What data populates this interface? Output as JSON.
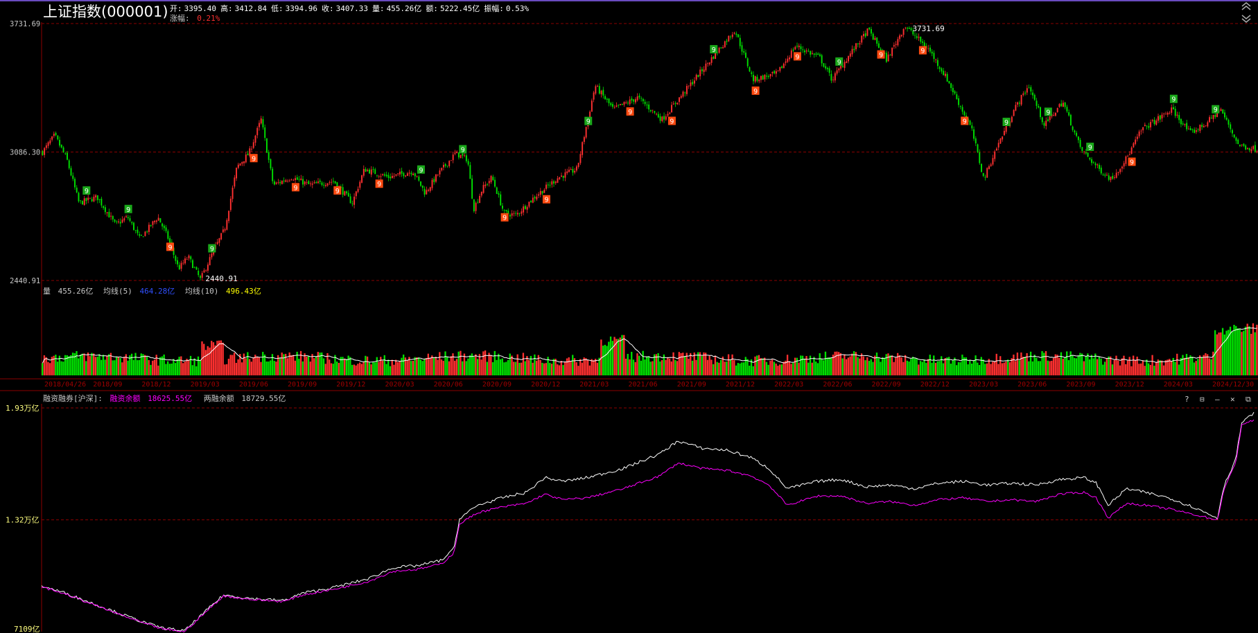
{
  "header": {
    "title": "上证指数(000001)",
    "ohlc_line": [
      {
        "k": "开:",
        "v": "3395.40"
      },
      {
        "k": "高:",
        "v": "3412.84"
      },
      {
        "k": "低:",
        "v": "3394.96"
      },
      {
        "k": "收:",
        "v": "3407.33"
      },
      {
        "k": "量:",
        "v": "455.26亿"
      },
      {
        "k": "额:",
        "v": "5222.45亿"
      },
      {
        "k": "振幅:",
        "v": "0.53%"
      }
    ],
    "change_label": "涨幅:",
    "change_value": "0.21%"
  },
  "volume_header": {
    "label": "量",
    "value": "455.26亿",
    "ma5_label": "均线(5)",
    "ma5_value": "464.28亿",
    "ma10_label": "均线(10)",
    "ma10_value": "496.43亿"
  },
  "margin_header": {
    "label": "融资融券[沪深]:",
    "rz_label": "融资余额",
    "rz_value": "18625.55亿",
    "lr_label": "两融余额",
    "lr_value": "18729.55亿"
  },
  "panel_buttons": [
    "?",
    "⊟",
    "–",
    "✕",
    "⧉"
  ],
  "colors": {
    "up": "#ff3030",
    "down": "#00e000",
    "grid": "#8b0000",
    "axis_text": "#c8c8c8",
    "rz_line": "#ff00ff",
    "lr_line": "#ffffff",
    "ma5": "#3050ff",
    "ma10": "#ffff00",
    "date_text": "#a00000",
    "td_green": "#1aa81a",
    "td_orange": "#ff4a10"
  },
  "chart_data": [
    {
      "type": "candlestick",
      "name": "price",
      "ylim": [
        2440.91,
        3731.69
      ],
      "yticks": [
        "3731.69",
        "3086.30",
        "2440.91"
      ],
      "high_label": "3731.69",
      "low_label": "2440.91",
      "keypoints": [
        {
          "t": 0.0,
          "v": 3086
        },
        {
          "t": 0.01,
          "v": 3170
        },
        {
          "t": 0.02,
          "v": 3050
        },
        {
          "t": 0.03,
          "v": 2830
        },
        {
          "t": 0.045,
          "v": 2860
        },
        {
          "t": 0.06,
          "v": 2720
        },
        {
          "t": 0.07,
          "v": 2760
        },
        {
          "t": 0.08,
          "v": 2650
        },
        {
          "t": 0.095,
          "v": 2760
        },
        {
          "t": 0.103,
          "v": 2660
        },
        {
          "t": 0.112,
          "v": 2500
        },
        {
          "t": 0.12,
          "v": 2560
        },
        {
          "t": 0.13,
          "v": 2445
        },
        {
          "t": 0.14,
          "v": 2580
        },
        {
          "t": 0.15,
          "v": 2700
        },
        {
          "t": 0.16,
          "v": 3010
        },
        {
          "t": 0.17,
          "v": 3080
        },
        {
          "t": 0.18,
          "v": 3250
        },
        {
          "t": 0.19,
          "v": 2920
        },
        {
          "t": 0.205,
          "v": 2960
        },
        {
          "t": 0.22,
          "v": 2920
        },
        {
          "t": 0.24,
          "v": 2940
        },
        {
          "t": 0.255,
          "v": 2830
        },
        {
          "t": 0.265,
          "v": 3000
        },
        {
          "t": 0.285,
          "v": 2960
        },
        {
          "t": 0.305,
          "v": 2990
        },
        {
          "t": 0.315,
          "v": 2880
        },
        {
          "t": 0.325,
          "v": 2970
        },
        {
          "t": 0.34,
          "v": 3080
        },
        {
          "t": 0.35,
          "v": 3050
        },
        {
          "t": 0.355,
          "v": 2800
        },
        {
          "t": 0.362,
          "v": 2900
        },
        {
          "t": 0.37,
          "v": 2960
        },
        {
          "t": 0.38,
          "v": 2780
        },
        {
          "t": 0.39,
          "v": 2770
        },
        {
          "t": 0.405,
          "v": 2860
        },
        {
          "t": 0.425,
          "v": 2960
        },
        {
          "t": 0.44,
          "v": 3000
        },
        {
          "t": 0.455,
          "v": 3420
        },
        {
          "t": 0.47,
          "v": 3300
        },
        {
          "t": 0.49,
          "v": 3360
        },
        {
          "t": 0.51,
          "v": 3250
        },
        {
          "t": 0.53,
          "v": 3400
        },
        {
          "t": 0.55,
          "v": 3550
        },
        {
          "t": 0.57,
          "v": 3700
        },
        {
          "t": 0.585,
          "v": 3450
        },
        {
          "t": 0.605,
          "v": 3480
        },
        {
          "t": 0.62,
          "v": 3620
        },
        {
          "t": 0.64,
          "v": 3560
        },
        {
          "t": 0.65,
          "v": 3450
        },
        {
          "t": 0.665,
          "v": 3580
        },
        {
          "t": 0.68,
          "v": 3700
        },
        {
          "t": 0.695,
          "v": 3550
        },
        {
          "t": 0.71,
          "v": 3720
        },
        {
          "t": 0.73,
          "v": 3600
        },
        {
          "t": 0.745,
          "v": 3450
        },
        {
          "t": 0.765,
          "v": 3200
        },
        {
          "t": 0.775,
          "v": 2950
        },
        {
          "t": 0.785,
          "v": 3100
        },
        {
          "t": 0.8,
          "v": 3300
        },
        {
          "t": 0.812,
          "v": 3420
        },
        {
          "t": 0.825,
          "v": 3220
        },
        {
          "t": 0.84,
          "v": 3340
        },
        {
          "t": 0.855,
          "v": 3100
        },
        {
          "t": 0.87,
          "v": 3000
        },
        {
          "t": 0.88,
          "v": 2950
        },
        {
          "t": 0.893,
          "v": 3060
        },
        {
          "t": 0.905,
          "v": 3200
        },
        {
          "t": 0.918,
          "v": 3250
        },
        {
          "t": 0.93,
          "v": 3300
        },
        {
          "t": 0.945,
          "v": 3180
        },
        {
          "t": 0.958,
          "v": 3230
        },
        {
          "t": 0.97,
          "v": 3300
        },
        {
          "t": 0.985,
          "v": 3120
        },
        {
          "t": 1.0,
          "v": 3100
        }
      ]
    },
    {
      "type": "bar",
      "name": "volume"
    },
    {
      "type": "line",
      "name": "margin",
      "ylim": [
        7109,
        19300
      ],
      "yticks": [
        "1.93万亿",
        "1.32万亿",
        "7109亿"
      ],
      "series": [
        {
          "name": "两融余额",
          "color": "#ffffff",
          "keypoints": [
            {
              "t": 0.0,
              "v": 9600
            },
            {
              "t": 0.02,
              "v": 9200
            },
            {
              "t": 0.06,
              "v": 8200
            },
            {
              "t": 0.085,
              "v": 7600
            },
            {
              "t": 0.1,
              "v": 7300
            },
            {
              "t": 0.118,
              "v": 7150
            },
            {
              "t": 0.135,
              "v": 8200
            },
            {
              "t": 0.15,
              "v": 9100
            },
            {
              "t": 0.175,
              "v": 8900
            },
            {
              "t": 0.2,
              "v": 8800
            },
            {
              "t": 0.215,
              "v": 9200
            },
            {
              "t": 0.24,
              "v": 9500
            },
            {
              "t": 0.27,
              "v": 10000
            },
            {
              "t": 0.29,
              "v": 10600
            },
            {
              "t": 0.31,
              "v": 10700
            },
            {
              "t": 0.33,
              "v": 11000
            },
            {
              "t": 0.34,
              "v": 11600
            },
            {
              "t": 0.345,
              "v": 13300
            },
            {
              "t": 0.36,
              "v": 14000
            },
            {
              "t": 0.38,
              "v": 14400
            },
            {
              "t": 0.4,
              "v": 14700
            },
            {
              "t": 0.415,
              "v": 15500
            },
            {
              "t": 0.43,
              "v": 15300
            },
            {
              "t": 0.45,
              "v": 15500
            },
            {
              "t": 0.48,
              "v": 16000
            },
            {
              "t": 0.51,
              "v": 16800
            },
            {
              "t": 0.525,
              "v": 17500
            },
            {
              "t": 0.545,
              "v": 17100
            },
            {
              "t": 0.565,
              "v": 17000
            },
            {
              "t": 0.585,
              "v": 16600
            },
            {
              "t": 0.6,
              "v": 16000
            },
            {
              "t": 0.615,
              "v": 14900
            },
            {
              "t": 0.64,
              "v": 15300
            },
            {
              "t": 0.66,
              "v": 15400
            },
            {
              "t": 0.68,
              "v": 15000
            },
            {
              "t": 0.7,
              "v": 15100
            },
            {
              "t": 0.72,
              "v": 14900
            },
            {
              "t": 0.74,
              "v": 15200
            },
            {
              "t": 0.76,
              "v": 15300
            },
            {
              "t": 0.78,
              "v": 15100
            },
            {
              "t": 0.8,
              "v": 15200
            },
            {
              "t": 0.82,
              "v": 15100
            },
            {
              "t": 0.84,
              "v": 15400
            },
            {
              "t": 0.86,
              "v": 15500
            },
            {
              "t": 0.87,
              "v": 15200
            },
            {
              "t": 0.88,
              "v": 14000
            },
            {
              "t": 0.895,
              "v": 14900
            },
            {
              "t": 0.91,
              "v": 14700
            },
            {
              "t": 0.93,
              "v": 14400
            },
            {
              "t": 0.95,
              "v": 13900
            },
            {
              "t": 0.97,
              "v": 13300
            },
            {
              "t": 0.975,
              "v": 15000
            },
            {
              "t": 0.985,
              "v": 16500
            },
            {
              "t": 0.99,
              "v": 18500
            },
            {
              "t": 1.0,
              "v": 19000
            }
          ]
        },
        {
          "name": "融资余额",
          "color": "#ff00ff",
          "keypoints": [
            {
              "t": 0.0,
              "v": 9550
            },
            {
              "t": 0.02,
              "v": 9150
            },
            {
              "t": 0.06,
              "v": 8150
            },
            {
              "t": 0.085,
              "v": 7550
            },
            {
              "t": 0.1,
              "v": 7250
            },
            {
              "t": 0.118,
              "v": 7109
            },
            {
              "t": 0.135,
              "v": 8150
            },
            {
              "t": 0.15,
              "v": 9050
            },
            {
              "t": 0.175,
              "v": 8850
            },
            {
              "t": 0.2,
              "v": 8750
            },
            {
              "t": 0.215,
              "v": 9100
            },
            {
              "t": 0.24,
              "v": 9400
            },
            {
              "t": 0.27,
              "v": 9850
            },
            {
              "t": 0.29,
              "v": 10400
            },
            {
              "t": 0.31,
              "v": 10500
            },
            {
              "t": 0.33,
              "v": 10800
            },
            {
              "t": 0.34,
              "v": 11400
            },
            {
              "t": 0.345,
              "v": 13000
            },
            {
              "t": 0.36,
              "v": 13600
            },
            {
              "t": 0.38,
              "v": 13900
            },
            {
              "t": 0.4,
              "v": 14100
            },
            {
              "t": 0.415,
              "v": 14600
            },
            {
              "t": 0.43,
              "v": 14300
            },
            {
              "t": 0.45,
              "v": 14400
            },
            {
              "t": 0.48,
              "v": 14900
            },
            {
              "t": 0.51,
              "v": 15600
            },
            {
              "t": 0.525,
              "v": 16300
            },
            {
              "t": 0.545,
              "v": 16000
            },
            {
              "t": 0.565,
              "v": 15900
            },
            {
              "t": 0.585,
              "v": 15600
            },
            {
              "t": 0.6,
              "v": 15100
            },
            {
              "t": 0.615,
              "v": 14000
            },
            {
              "t": 0.64,
              "v": 14500
            },
            {
              "t": 0.66,
              "v": 14500
            },
            {
              "t": 0.68,
              "v": 14100
            },
            {
              "t": 0.7,
              "v": 14200
            },
            {
              "t": 0.72,
              "v": 14000
            },
            {
              "t": 0.74,
              "v": 14300
            },
            {
              "t": 0.76,
              "v": 14400
            },
            {
              "t": 0.78,
              "v": 14200
            },
            {
              "t": 0.8,
              "v": 14300
            },
            {
              "t": 0.82,
              "v": 14200
            },
            {
              "t": 0.84,
              "v": 14600
            },
            {
              "t": 0.86,
              "v": 14700
            },
            {
              "t": 0.87,
              "v": 14400
            },
            {
              "t": 0.88,
              "v": 13300
            },
            {
              "t": 0.895,
              "v": 14100
            },
            {
              "t": 0.91,
              "v": 14000
            },
            {
              "t": 0.93,
              "v": 13800
            },
            {
              "t": 0.95,
              "v": 13500
            },
            {
              "t": 0.97,
              "v": 13200
            },
            {
              "t": 0.975,
              "v": 14800
            },
            {
              "t": 0.985,
              "v": 16300
            },
            {
              "t": 0.99,
              "v": 18400
            },
            {
              "t": 1.0,
              "v": 18625
            }
          ]
        }
      ]
    }
  ],
  "x_axis_dates": [
    "2018/04/26",
    "2018/09",
    "2018/12",
    "2019/03",
    "2019/06",
    "2019/09",
    "2019/12",
    "2020/03",
    "2020/06",
    "2020/09",
    "2020/12",
    "2021/03",
    "2021/06",
    "2021/09",
    "2021/12",
    "2022/03",
    "2022/06",
    "2022/09",
    "2022/12",
    "2023/03",
    "2023/06",
    "2023/09",
    "2023/12",
    "2024/03",
    "2024/12/30"
  ]
}
